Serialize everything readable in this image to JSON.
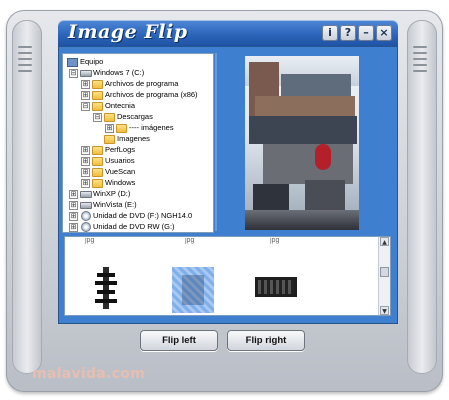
{
  "app": {
    "title": "Image Flip"
  },
  "title_buttons": {
    "info": "i",
    "help": "?",
    "minimize": "–",
    "close": "×"
  },
  "tree": {
    "root": "Equipo",
    "items": [
      {
        "label": "Windows 7 (C:)",
        "type": "drive",
        "expander": "⊟"
      },
      {
        "label": "Archivos de programa",
        "type": "folder",
        "expander": "⊞"
      },
      {
        "label": "Archivos de programa (x86)",
        "type": "folder",
        "expander": "⊞"
      },
      {
        "label": "Ontecnia",
        "type": "folder",
        "expander": "⊟"
      },
      {
        "label": "Descargas",
        "type": "folder",
        "expander": "⊟"
      },
      {
        "label": "---- imágenes",
        "type": "folder",
        "expander": "⊞"
      },
      {
        "label": "Imagenes",
        "type": "folder",
        "expander": ""
      },
      {
        "label": "PerfLogs",
        "type": "folder",
        "expander": "⊞"
      },
      {
        "label": "Usuarios",
        "type": "folder",
        "expander": "⊞"
      },
      {
        "label": "VueScan",
        "type": "folder",
        "expander": "⊞"
      },
      {
        "label": "Windows",
        "type": "folder",
        "expander": "⊞"
      },
      {
        "label": "WinXP (D:)",
        "type": "drive",
        "expander": "⊞"
      },
      {
        "label": "WinVista (E:)",
        "type": "drive",
        "expander": "⊞"
      },
      {
        "label": "Unidad de DVD (F:) NGH14.0",
        "type": "dvd",
        "expander": "⊞"
      },
      {
        "label": "Unidad de DVD RW (G:)",
        "type": "dvd",
        "expander": "⊞"
      }
    ]
  },
  "thumbnails": {
    "captions": [
      "jpg",
      "jpg",
      "jpg"
    ],
    "scroll_up": "▲",
    "scroll_down": "▼"
  },
  "buttons": {
    "flip_left": "Flip left",
    "flip_right": "Flip right"
  },
  "watermark": "malavida.com",
  "colors": {
    "accent": "#3f7fcf",
    "titlebar": "#2a63b8"
  }
}
